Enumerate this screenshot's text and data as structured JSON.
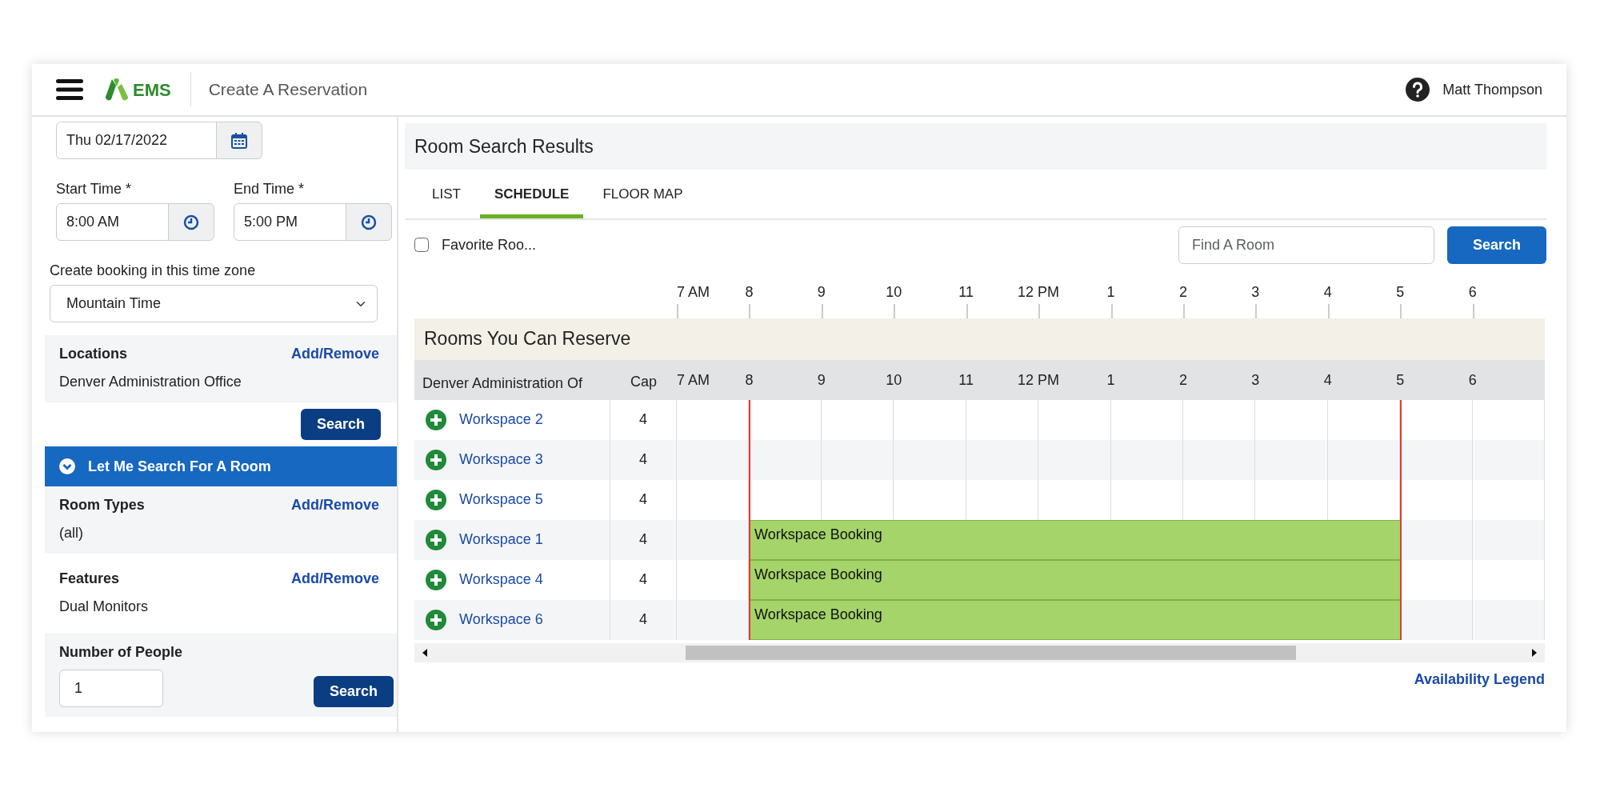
{
  "header": {
    "app_name": "EMS",
    "page_title": "Create A Reservation",
    "user_name": "Matt Thompson"
  },
  "booking_form": {
    "date": "Thu 02/17/2022",
    "start_time": {
      "label": "Start Time *",
      "value": "8:00 AM"
    },
    "end_time": {
      "label": "End Time *",
      "value": "5:00 PM"
    },
    "time_zone": {
      "label": "Create booking in this time zone",
      "value": "Mountain Time"
    },
    "locations": {
      "label": "Locations",
      "action": "Add/Remove",
      "value": "Denver Administration Office"
    },
    "search_button": "Search"
  },
  "room_search": {
    "title": "Let Me Search For A Room",
    "expanded": true,
    "filters": [
      {
        "kind": "list",
        "label": "Room Types",
        "action": "Add/Remove",
        "value": "(all)"
      },
      {
        "kind": "list",
        "label": "Features",
        "action": "Add/Remove",
        "value": "Dual Monitors"
      },
      {
        "kind": "number",
        "label": "Number of People",
        "value": "1"
      }
    ],
    "search_button": "Search"
  },
  "results": {
    "title": "Room Search Results",
    "tabs": [
      {
        "label": "LIST",
        "selected": false
      },
      {
        "label": "SCHEDULE",
        "selected": true
      },
      {
        "label": "FLOOR MAP",
        "selected": false
      }
    ],
    "favorites": {
      "label": "Favorite Roo...",
      "checked": false
    },
    "find": {
      "placeholder": "Find A Room",
      "button": "Search"
    },
    "axis_hours": [
      "7 AM",
      "8",
      "9",
      "10",
      "11",
      "12 PM",
      "1",
      "2",
      "3",
      "4",
      "5",
      "6"
    ],
    "section_title": "Rooms You Can Reserve",
    "columns": [
      "Denver Administration Of",
      "Cap"
    ],
    "header_hours": [
      {
        "label": "7 AM",
        "business_start": false,
        "business_end": false
      },
      {
        "label": "8",
        "business_start": true,
        "business_end": false
      },
      {
        "label": "9",
        "business_start": false,
        "business_end": false
      },
      {
        "label": "10",
        "business_start": false,
        "business_end": false
      },
      {
        "label": "11",
        "business_start": false,
        "business_end": false
      },
      {
        "label": "12 PM",
        "business_start": false,
        "business_end": false
      },
      {
        "label": "1",
        "business_start": false,
        "business_end": false
      },
      {
        "label": "2",
        "business_start": false,
        "business_end": false
      },
      {
        "label": "3",
        "business_start": false,
        "business_end": false
      },
      {
        "label": "4",
        "business_start": false,
        "business_end": false
      },
      {
        "label": "5",
        "business_start": false,
        "business_end": true
      },
      {
        "label": "6",
        "business_start": false,
        "business_end": false
      }
    ],
    "rooms": [
      {
        "name": "Workspace 2",
        "capacity": "4"
      },
      {
        "name": "Workspace 3",
        "capacity": "4"
      },
      {
        "name": "Workspace 5",
        "capacity": "4"
      },
      {
        "name": "Workspace 1",
        "capacity": "4",
        "booking_label": "Workspace Booking"
      },
      {
        "name": "Workspace 4",
        "capacity": "4",
        "booking_label": "Workspace Booking"
      },
      {
        "name": "Workspace 6",
        "capacity": "4",
        "booking_label": "Workspace Booking"
      }
    ],
    "legend_link": "Availability Legend"
  }
}
